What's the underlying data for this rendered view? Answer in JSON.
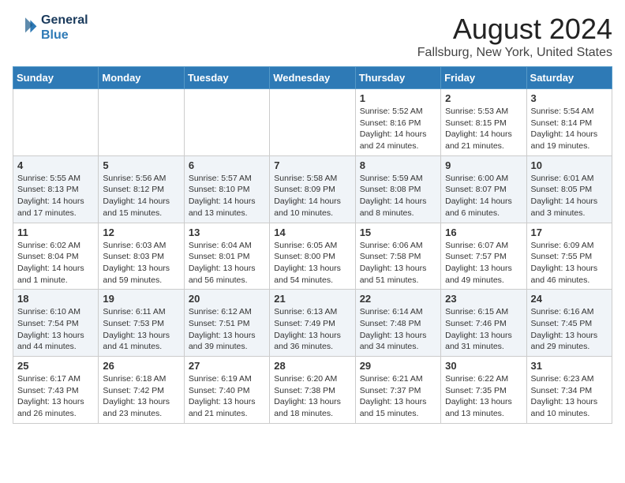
{
  "logo": {
    "line1": "General",
    "line2": "Blue"
  },
  "title": "August 2024",
  "subtitle": "Fallsburg, New York, United States",
  "days_header": [
    "Sunday",
    "Monday",
    "Tuesday",
    "Wednesday",
    "Thursday",
    "Friday",
    "Saturday"
  ],
  "weeks": [
    [
      {
        "num": "",
        "info": ""
      },
      {
        "num": "",
        "info": ""
      },
      {
        "num": "",
        "info": ""
      },
      {
        "num": "",
        "info": ""
      },
      {
        "num": "1",
        "info": "Sunrise: 5:52 AM\nSunset: 8:16 PM\nDaylight: 14 hours\nand 24 minutes."
      },
      {
        "num": "2",
        "info": "Sunrise: 5:53 AM\nSunset: 8:15 PM\nDaylight: 14 hours\nand 21 minutes."
      },
      {
        "num": "3",
        "info": "Sunrise: 5:54 AM\nSunset: 8:14 PM\nDaylight: 14 hours\nand 19 minutes."
      }
    ],
    [
      {
        "num": "4",
        "info": "Sunrise: 5:55 AM\nSunset: 8:13 PM\nDaylight: 14 hours\nand 17 minutes."
      },
      {
        "num": "5",
        "info": "Sunrise: 5:56 AM\nSunset: 8:12 PM\nDaylight: 14 hours\nand 15 minutes."
      },
      {
        "num": "6",
        "info": "Sunrise: 5:57 AM\nSunset: 8:10 PM\nDaylight: 14 hours\nand 13 minutes."
      },
      {
        "num": "7",
        "info": "Sunrise: 5:58 AM\nSunset: 8:09 PM\nDaylight: 14 hours\nand 10 minutes."
      },
      {
        "num": "8",
        "info": "Sunrise: 5:59 AM\nSunset: 8:08 PM\nDaylight: 14 hours\nand 8 minutes."
      },
      {
        "num": "9",
        "info": "Sunrise: 6:00 AM\nSunset: 8:07 PM\nDaylight: 14 hours\nand 6 minutes."
      },
      {
        "num": "10",
        "info": "Sunrise: 6:01 AM\nSunset: 8:05 PM\nDaylight: 14 hours\nand 3 minutes."
      }
    ],
    [
      {
        "num": "11",
        "info": "Sunrise: 6:02 AM\nSunset: 8:04 PM\nDaylight: 14 hours\nand 1 minute."
      },
      {
        "num": "12",
        "info": "Sunrise: 6:03 AM\nSunset: 8:03 PM\nDaylight: 13 hours\nand 59 minutes."
      },
      {
        "num": "13",
        "info": "Sunrise: 6:04 AM\nSunset: 8:01 PM\nDaylight: 13 hours\nand 56 minutes."
      },
      {
        "num": "14",
        "info": "Sunrise: 6:05 AM\nSunset: 8:00 PM\nDaylight: 13 hours\nand 54 minutes."
      },
      {
        "num": "15",
        "info": "Sunrise: 6:06 AM\nSunset: 7:58 PM\nDaylight: 13 hours\nand 51 minutes."
      },
      {
        "num": "16",
        "info": "Sunrise: 6:07 AM\nSunset: 7:57 PM\nDaylight: 13 hours\nand 49 minutes."
      },
      {
        "num": "17",
        "info": "Sunrise: 6:09 AM\nSunset: 7:55 PM\nDaylight: 13 hours\nand 46 minutes."
      }
    ],
    [
      {
        "num": "18",
        "info": "Sunrise: 6:10 AM\nSunset: 7:54 PM\nDaylight: 13 hours\nand 44 minutes."
      },
      {
        "num": "19",
        "info": "Sunrise: 6:11 AM\nSunset: 7:53 PM\nDaylight: 13 hours\nand 41 minutes."
      },
      {
        "num": "20",
        "info": "Sunrise: 6:12 AM\nSunset: 7:51 PM\nDaylight: 13 hours\nand 39 minutes."
      },
      {
        "num": "21",
        "info": "Sunrise: 6:13 AM\nSunset: 7:49 PM\nDaylight: 13 hours\nand 36 minutes."
      },
      {
        "num": "22",
        "info": "Sunrise: 6:14 AM\nSunset: 7:48 PM\nDaylight: 13 hours\nand 34 minutes."
      },
      {
        "num": "23",
        "info": "Sunrise: 6:15 AM\nSunset: 7:46 PM\nDaylight: 13 hours\nand 31 minutes."
      },
      {
        "num": "24",
        "info": "Sunrise: 6:16 AM\nSunset: 7:45 PM\nDaylight: 13 hours\nand 29 minutes."
      }
    ],
    [
      {
        "num": "25",
        "info": "Sunrise: 6:17 AM\nSunset: 7:43 PM\nDaylight: 13 hours\nand 26 minutes."
      },
      {
        "num": "26",
        "info": "Sunrise: 6:18 AM\nSunset: 7:42 PM\nDaylight: 13 hours\nand 23 minutes."
      },
      {
        "num": "27",
        "info": "Sunrise: 6:19 AM\nSunset: 7:40 PM\nDaylight: 13 hours\nand 21 minutes."
      },
      {
        "num": "28",
        "info": "Sunrise: 6:20 AM\nSunset: 7:38 PM\nDaylight: 13 hours\nand 18 minutes."
      },
      {
        "num": "29",
        "info": "Sunrise: 6:21 AM\nSunset: 7:37 PM\nDaylight: 13 hours\nand 15 minutes."
      },
      {
        "num": "30",
        "info": "Sunrise: 6:22 AM\nSunset: 7:35 PM\nDaylight: 13 hours\nand 13 minutes."
      },
      {
        "num": "31",
        "info": "Sunrise: 6:23 AM\nSunset: 7:34 PM\nDaylight: 13 hours\nand 10 minutes."
      }
    ]
  ]
}
